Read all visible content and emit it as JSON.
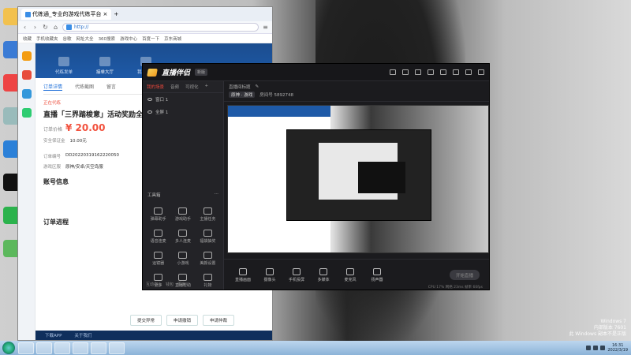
{
  "browser": {
    "tab_title": "代练通_专业的游戏代练平台",
    "url": "http://",
    "favorites": [
      "收藏",
      "手机收藏夹",
      "谷歌",
      "网址大全",
      "360搜索",
      "游戏中心",
      "百度一下",
      "京东商城"
    ],
    "site_nav": [
      {
        "label": "代练发单",
        "active": false
      },
      {
        "label": "接单大厅",
        "active": true
      },
      {
        "label": "我要接单",
        "active": false
      }
    ],
    "subtabs": [
      "订单详情",
      "代练截图",
      "留言"
    ],
    "order_status": "正在代练",
    "order_title": "直播「三界踏梭意」活动奖励全字",
    "price_label": "订单价格",
    "price": "¥ 20.00",
    "security_label": "安全保证金",
    "security_value": "10.00元",
    "order_no_label": "订单编号",
    "order_no": "DD20220319162220050",
    "game_label": "游戏区服",
    "game_value": "原神/安卓/天空岛服",
    "account_title": "账号信息",
    "progress_title": "订单进程",
    "buttons": [
      "提交异常",
      "申请撤销",
      "申请仲裁"
    ],
    "footer_links": [
      "下载APP",
      "关于我们"
    ]
  },
  "app": {
    "logo_text": "直播伴侣",
    "version_badge": "新版",
    "left_tabs": [
      "我的场景",
      "音频",
      "可视化"
    ],
    "scenes": [
      "窗口 1",
      "全屏 1"
    ],
    "tools_title": "工具箱",
    "tools": [
      "弹幕助手",
      "游戏助手",
      "主播任务",
      "语音连麦",
      "多人连麦",
      "福袋抽奖",
      "运镜器",
      "小游戏",
      "美颜设置",
      "更多",
      "直播帮助",
      "礼物"
    ],
    "left_footer": "互动中心　钱包　更多",
    "room_title": "直播间标题",
    "room_tag1": "原神 · 游戏",
    "room_meta": "房间号 5892748",
    "controls": [
      "直播画面",
      "摄像头",
      "手机投屏",
      "多媒体",
      "麦克风",
      "扬声器"
    ],
    "go_live": "开始直播",
    "perf": "CPU 17%  网络 23ms  帧率 60fps"
  },
  "taskbar": {
    "time": "16:31",
    "date": "2022/3/19"
  },
  "watermark": {
    "line1": "Windows 7",
    "line2": "内部版本 7601",
    "line3": "此 Windows 副本不是正版"
  },
  "colors": {
    "brand_blue": "#1e5aa8",
    "price_red": "#f2513d",
    "app_bg": "#1f1f22",
    "accent_red": "#e8473b"
  }
}
